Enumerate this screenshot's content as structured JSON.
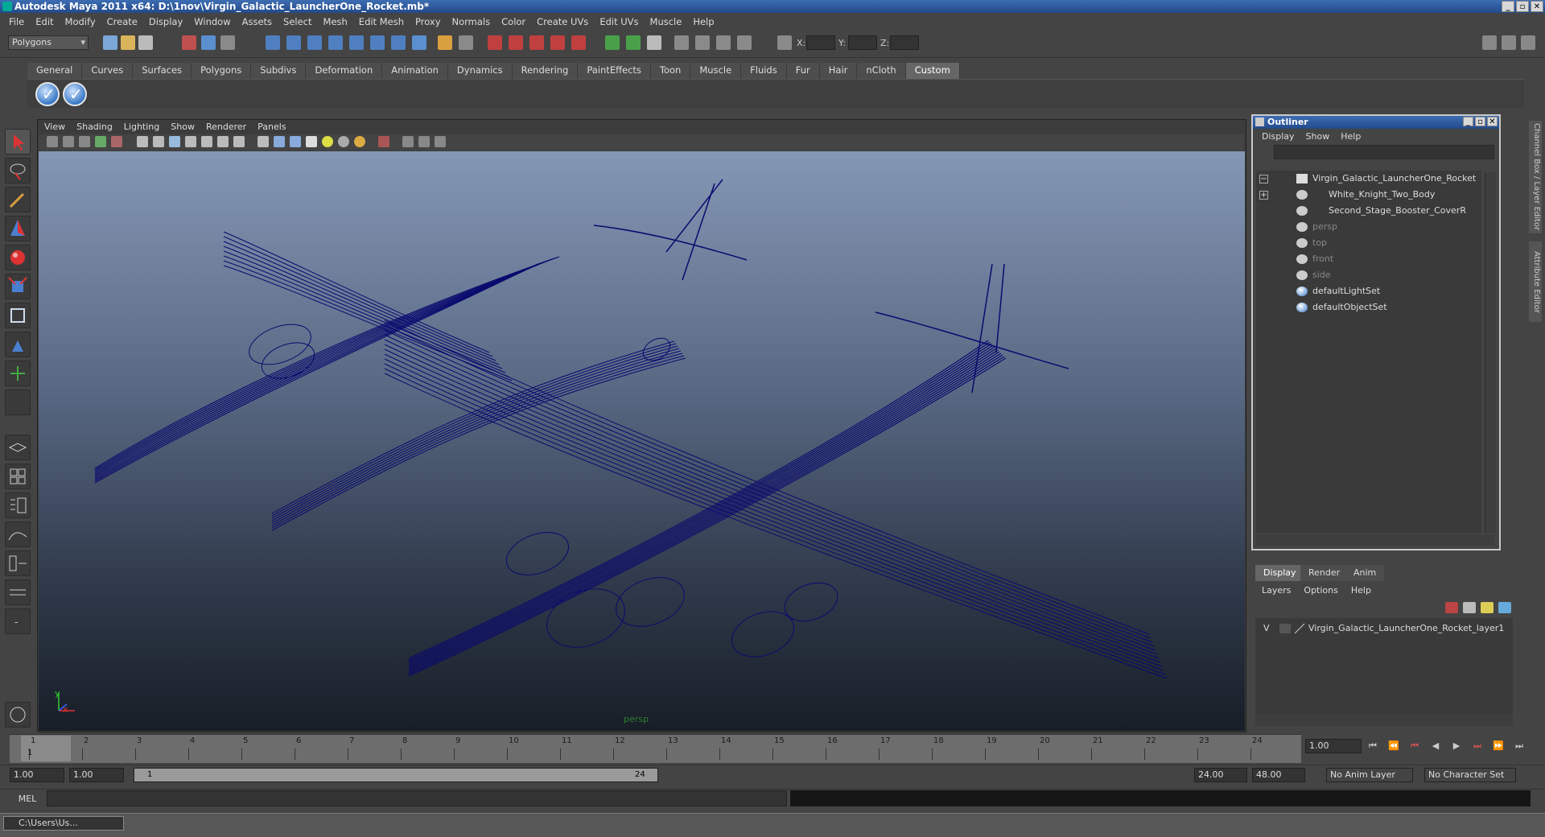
{
  "window": {
    "title": "Autodesk Maya 2011 x64: D:\\1nov\\Virgin_Galactic_LauncherOne_Rocket.mb*"
  },
  "menus": [
    "File",
    "Edit",
    "Modify",
    "Create",
    "Display",
    "Window",
    "Assets",
    "Select",
    "Mesh",
    "Edit Mesh",
    "Proxy",
    "Normals",
    "Color",
    "Create UVs",
    "Edit UVs",
    "Muscle",
    "Help"
  ],
  "statusline": {
    "mode": "Polygons",
    "x_label": "X:",
    "y_label": "Y:",
    "z_label": "Z:"
  },
  "shelf_tabs": [
    "General",
    "Curves",
    "Surfaces",
    "Polygons",
    "Subdivs",
    "Deformation",
    "Animation",
    "Dynamics",
    "Rendering",
    "PaintEffects",
    "Toon",
    "Muscle",
    "Fluids",
    "Fur",
    "Hair",
    "nCloth",
    "Custom"
  ],
  "shelf_active": "Custom",
  "viewport": {
    "menus": [
      "View",
      "Shading",
      "Lighting",
      "Show",
      "Renderer",
      "Panels"
    ],
    "camera_label": "persp",
    "axis_y": "y",
    "axis_x": "x",
    "wire_color": "#0a0a6e"
  },
  "outliner": {
    "title": "Outliner",
    "menus": [
      "Display",
      "Show",
      "Help"
    ],
    "items": [
      {
        "label": "Virgin_Galactic_LauncherOne_Rocket",
        "dim": false,
        "expand": "−"
      },
      {
        "label": "White_Knight_Two_Body",
        "dim": false,
        "expand": "+"
      },
      {
        "label": "Second_Stage_Booster_CoverR",
        "dim": false,
        "expand": ""
      },
      {
        "label": "persp",
        "dim": true,
        "expand": ""
      },
      {
        "label": "top",
        "dim": true,
        "expand": ""
      },
      {
        "label": "front",
        "dim": true,
        "expand": ""
      },
      {
        "label": "side",
        "dim": true,
        "expand": ""
      },
      {
        "label": "defaultLightSet",
        "dim": false,
        "expand": ""
      },
      {
        "label": "defaultObjectSet",
        "dim": false,
        "expand": ""
      }
    ]
  },
  "side_tabs": [
    "Channel Box / Layer Editor",
    "Attribute Editor"
  ],
  "layer_editor": {
    "tabs": [
      "Display",
      "Render",
      "Anim"
    ],
    "active_tab": "Display",
    "menus": [
      "Layers",
      "Options",
      "Help"
    ],
    "layer_visible": "V",
    "layer_name": "Virgin_Galactic_LauncherOne_Rocket_layer1"
  },
  "timeline": {
    "ticks": [
      "1",
      "2",
      "3",
      "4",
      "5",
      "6",
      "7",
      "8",
      "9",
      "10",
      "11",
      "12",
      "13",
      "14",
      "15",
      "16",
      "17",
      "18",
      "19",
      "20",
      "21",
      "22",
      "23",
      "24"
    ],
    "current_frame_marker": "1",
    "current_frame": "1.00"
  },
  "range": {
    "start": "1.00",
    "playback_start": "1.00",
    "slider_start": "1",
    "slider_end": "24",
    "playback_end": "24.00",
    "end": "48.00",
    "anim_layer": "No Anim Layer",
    "character_set": "No Character Set"
  },
  "command_line": {
    "label": "MEL"
  },
  "taskbar": {
    "item": "C:\\Users\\Us..."
  }
}
